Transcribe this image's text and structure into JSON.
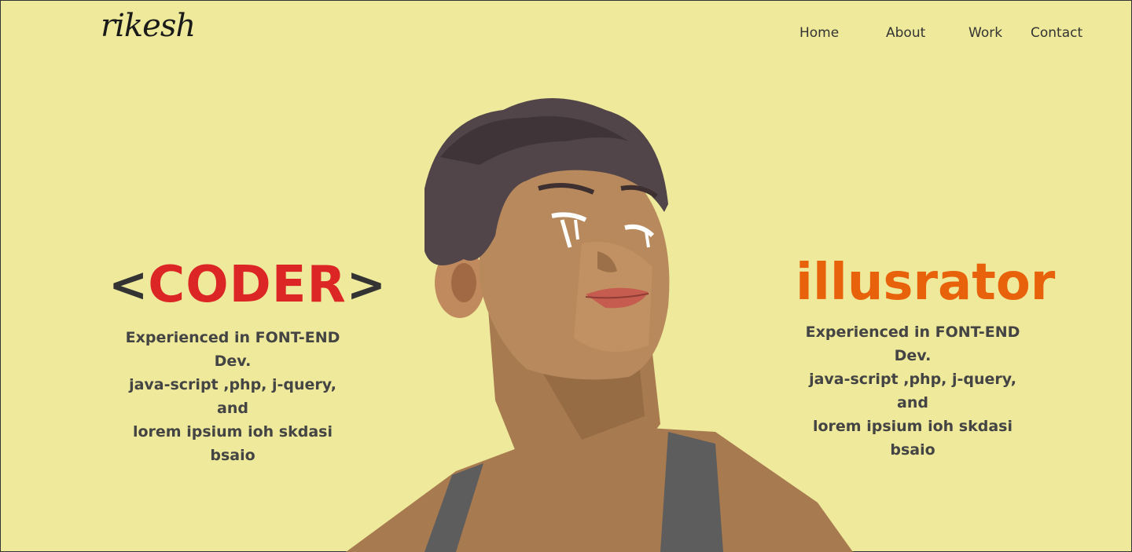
{
  "logo": {
    "text": "rikesh"
  },
  "nav": [
    {
      "label": "Home"
    },
    {
      "label": "About"
    },
    {
      "label": "Work"
    },
    {
      "label": "Contact"
    }
  ],
  "coder": {
    "open_bracket": "<",
    "title": "CODER",
    "close_bracket": ">",
    "lines": [
      "Experienced in FONT-END Dev.",
      "java-script ,php, j-query, and",
      "lorem ipsium ioh skdasi bsaio"
    ]
  },
  "illustrator": {
    "title": "illusrator",
    "lines": [
      "Experienced in FONT-END Dev.",
      "java-script ,php, j-query, and",
      "lorem ipsium ioh skdasi bsaio"
    ]
  },
  "colors": {
    "background": "#eee99b",
    "coder_accent": "#dc2626",
    "illustrator_accent": "#e8620c",
    "text": "#444444"
  },
  "hero_image": {
    "icon": "portrait-illustration"
  }
}
